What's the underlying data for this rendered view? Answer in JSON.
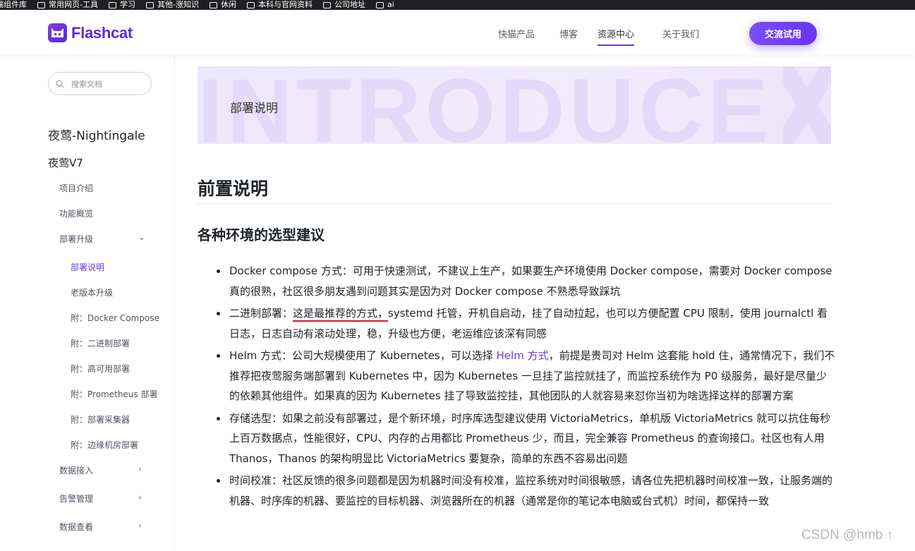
{
  "bookmarks": [
    {
      "label": "端组件库"
    },
    {
      "label": "常用网页-工具"
    },
    {
      "label": "学习"
    },
    {
      "label": "其他-涨知识"
    },
    {
      "label": "休闲"
    },
    {
      "label": "本科与官网资料"
    },
    {
      "label": "公司地址"
    },
    {
      "label": "ai"
    }
  ],
  "header": {
    "logo_text": "Flashcat",
    "nav": [
      {
        "label": "快猫产品"
      },
      {
        "label": "博客"
      },
      {
        "label": "资源中心"
      },
      {
        "label": "关于我们"
      }
    ],
    "active_nav": "资源中心",
    "cta_label": "交流试用"
  },
  "sidebar": {
    "search_placeholder": "搜索文档",
    "section_title": "夜莺-Nightingale",
    "version_title": "夜莺V7",
    "items": [
      {
        "label": "项目介绍"
      },
      {
        "label": "功能概览"
      },
      {
        "label": "部署升级"
      },
      {
        "label": "部署说明"
      },
      {
        "label": "老版本升级"
      },
      {
        "label": "附：Docker Compose"
      },
      {
        "label": "附：二进制部署"
      },
      {
        "label": "附：高可用部署"
      },
      {
        "label": "附：Prometheus 部署"
      },
      {
        "label": "附：部署采集器"
      },
      {
        "label": "附：边缘机房部署"
      },
      {
        "label": "数据接入"
      },
      {
        "label": "告警管理"
      },
      {
        "label": "数据查看"
      }
    ]
  },
  "banner": {
    "background_text": "INTRODUCE",
    "title": "部署说明"
  },
  "content": {
    "h1": "前置说明",
    "h2": "各种环境的选型建议",
    "items": [
      {
        "text": "Docker compose 方式：可用于快速测试，不建议上生产，如果要生产环境使用 Docker compose，需要对 Docker compose 真的很熟，社区很多朋友遇到问题其实是因为对 Docker compose 不熟悉导致踩坑"
      },
      {
        "prefix": "二进制部署：",
        "marked": "这是最推荐的方式，",
        "rest": "systemd 托管，开机自启动，挂了自动拉起，也可以方便配置 CPU 限制，使用 journalctl 看日志，日志自动有滚动处理，稳，升级也方便，老运维应该深有同感"
      },
      {
        "prefix": "Helm 方式：公司大规模使用了 Kubernetes，可以选择 ",
        "link": "Helm 方式",
        "rest": "，前提是贵司对 Helm 这套能 hold 住，通常情况下，我们不推荐把夜莺服务端部署到 Kubernetes 中，因为 Kubernetes 一旦挂了监控就挂了，而监控系统作为 P0 级服务，最好是尽量少的依赖其他组件。如果真的因为 Kubernetes 挂了导致监控挂，其他团队的人就容易来怼你当初为啥选择这样的部署方案"
      },
      {
        "text": "存储选型：如果之前没有部署过，是个新环境，时序库选型建议使用 VictoriaMetrics，单机版 VictoriaMetrics 就可以抗住每秒上百万数据点，性能很好，CPU、内存的占用都比 Prometheus 少，而且，完全兼容 Prometheus 的查询接口。社区也有人用 Thanos，Thanos 的架构明显比 VictoriaMetrics 要复杂，简单的东西不容易出问题"
      },
      {
        "text": "时间校准：社区反馈的很多问题都是因为机器时间没有校准，监控系统对时间很敏感，请各位先把机器时间校准一致，让服务端的机器、时序库的机器、要监控的目标机器、浏览器所在的机器（通常是你的笔记本电脑或台式机）时间，都保持一致"
      }
    ]
  },
  "watermark": "CSDN @hmb ↑",
  "colors": {
    "brand": "#6a3ce6",
    "cta_start": "#7c4dfa",
    "underline_mark": "#e0141e"
  }
}
